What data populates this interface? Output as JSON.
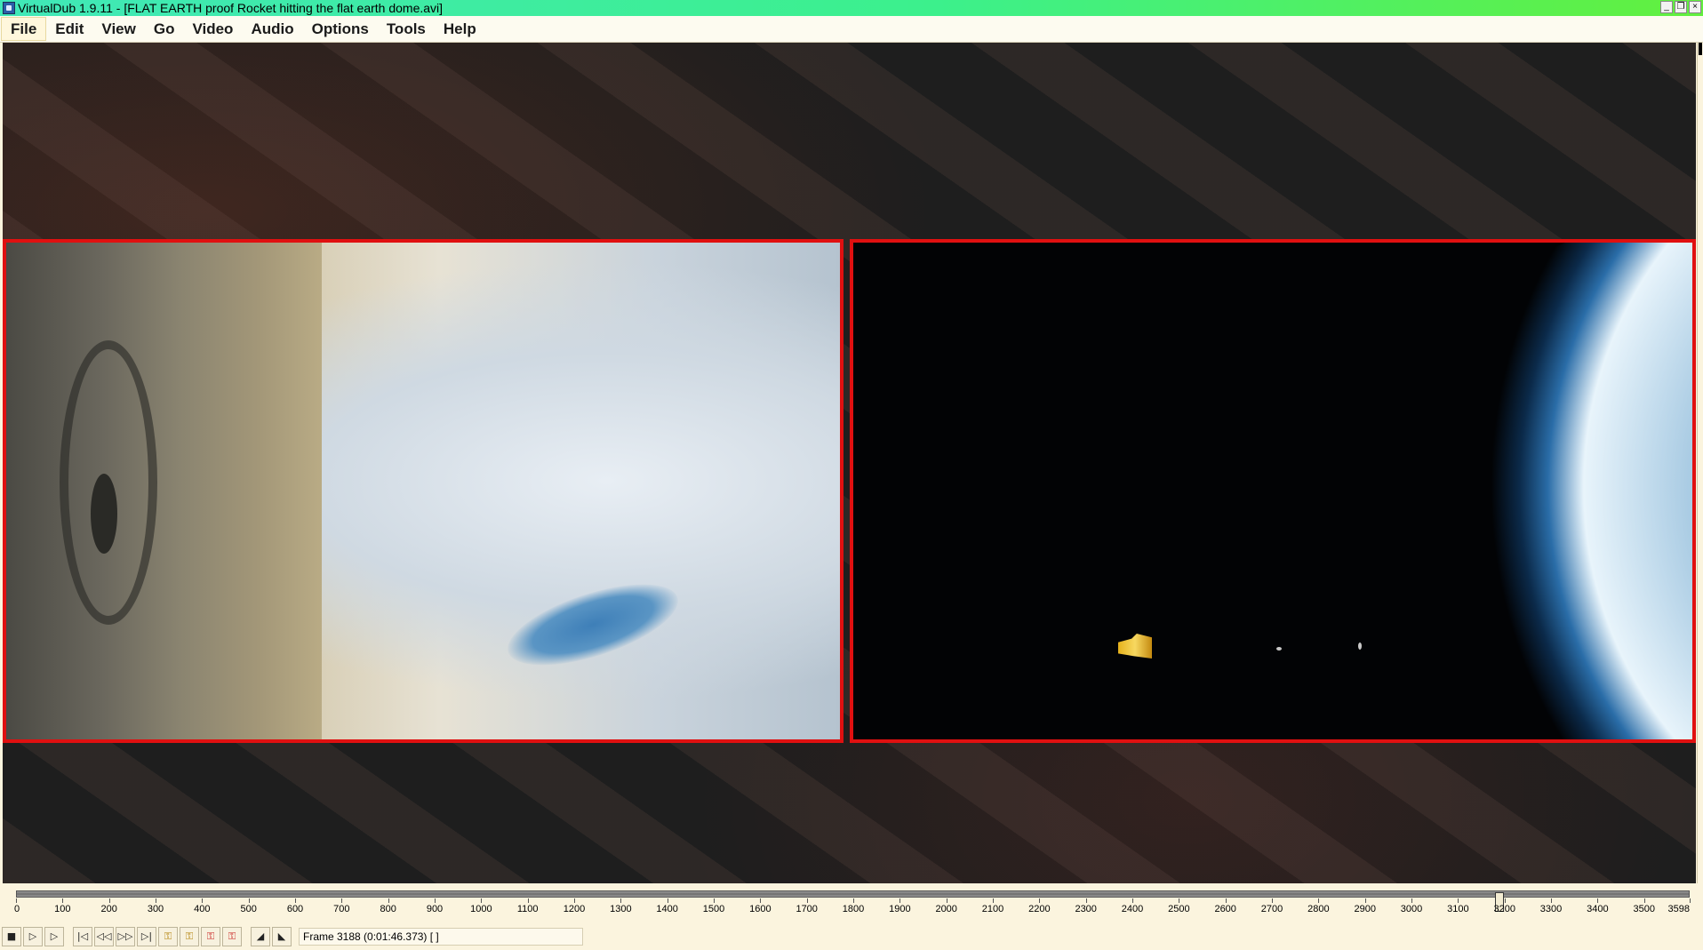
{
  "window": {
    "title": "VirtualDub 1.9.11 - [FLAT EARTH proof Rocket hitting the flat earth dome.avi]",
    "controls": [
      "_",
      "❐",
      "×"
    ]
  },
  "menu": {
    "items": [
      "File",
      "Edit",
      "View",
      "Go",
      "Video",
      "Audio",
      "Options",
      "Tools",
      "Help"
    ]
  },
  "timeline": {
    "total_frames": 3598,
    "current_frame": 3188,
    "tick_labels": [
      "0",
      "100",
      "200",
      "300",
      "400",
      "500",
      "600",
      "700",
      "800",
      "900",
      "1000",
      "1100",
      "1200",
      "1300",
      "1400",
      "1500",
      "1600",
      "1700",
      "1800",
      "1900",
      "2000",
      "2100",
      "2200",
      "2300",
      "2400",
      "2500",
      "2600",
      "2700",
      "2800",
      "2900",
      "3000",
      "3100",
      "3200",
      "3300",
      "3400",
      "3500",
      "3598"
    ]
  },
  "toolbar": {
    "buttons": [
      {
        "name": "stop-button",
        "glyph": "■"
      },
      {
        "name": "play-input-button",
        "glyph": "▷"
      },
      {
        "name": "play-output-button",
        "glyph": "▷"
      },
      {
        "name": "go-start-button",
        "glyph": "|◁"
      },
      {
        "name": "prev-frame-button",
        "glyph": "◁◁"
      },
      {
        "name": "next-frame-button",
        "glyph": "▷▷"
      },
      {
        "name": "go-end-button",
        "glyph": "▷|"
      },
      {
        "name": "prev-keyframe-button",
        "glyph": "⚿"
      },
      {
        "name": "next-keyframe-button",
        "glyph": "⚿"
      },
      {
        "name": "scene-back-button",
        "glyph": "⚿"
      },
      {
        "name": "scene-forward-button",
        "glyph": "⚿"
      },
      {
        "name": "mark-in-button",
        "glyph": "◢"
      },
      {
        "name": "mark-out-button",
        "glyph": "◣"
      }
    ],
    "frame_status": "Frame 3188 (0:01:46.373) [ ]"
  }
}
